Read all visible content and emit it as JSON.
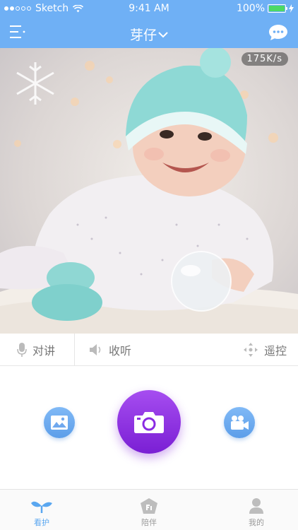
{
  "status_bar": {
    "carrier": "Sketch",
    "time": "9:41 AM",
    "battery": "100%",
    "battery_level": 1.0
  },
  "nav": {
    "title": "芽仔",
    "menu_icon": "menu-icon",
    "chat_icon": "chat-bubble-icon"
  },
  "video": {
    "speed": "175K/s"
  },
  "controls": {
    "talk": "对讲",
    "listen": "收听",
    "remote": "遥控"
  },
  "actions": {
    "gallery_icon": "image-gallery-icon",
    "camera_icon": "camera-icon",
    "video_icon": "video-camera-icon"
  },
  "tabs": [
    {
      "label": "看护",
      "icon": "sprout-icon",
      "active": true
    },
    {
      "label": "陪伴",
      "icon": "companion-icon",
      "active": false
    },
    {
      "label": "我的",
      "icon": "person-icon",
      "active": false
    }
  ],
  "colors": {
    "header": "#6fb0f5",
    "accent_blue": "#5aa7f0",
    "camera_purple": "#8a2be2",
    "battery_green": "#4cd964"
  }
}
